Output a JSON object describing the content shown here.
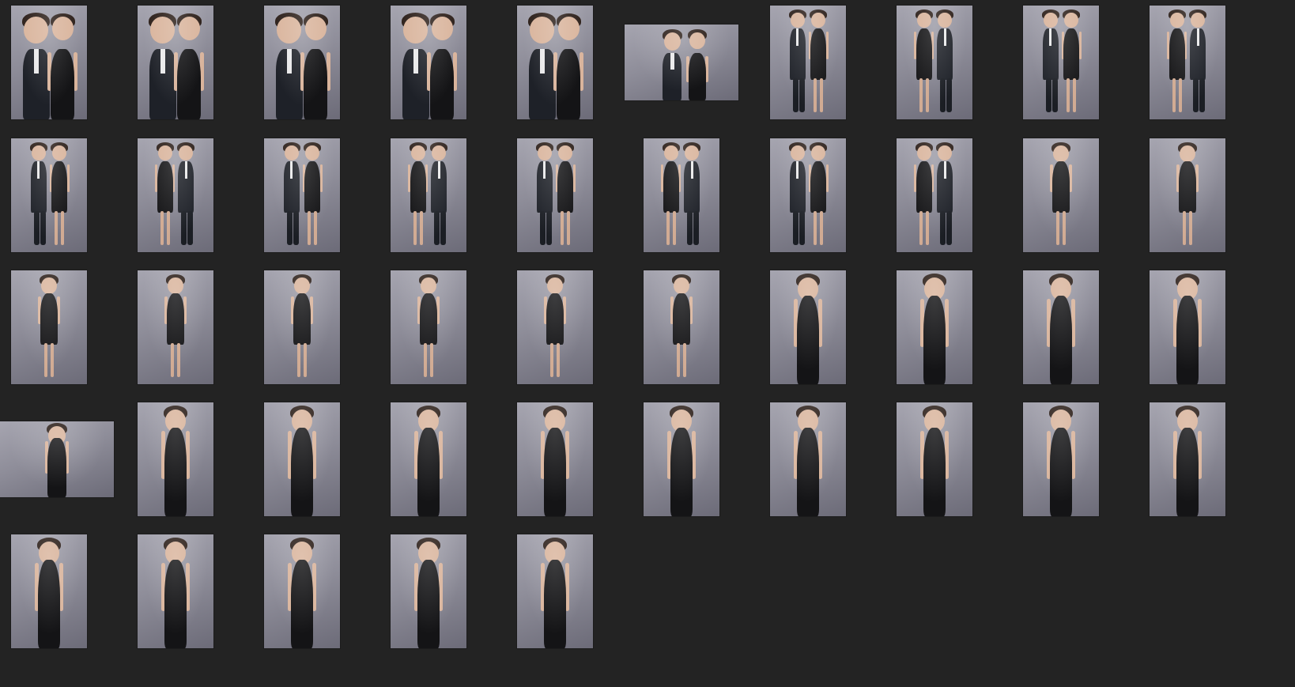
{
  "gallery": {
    "background_color": "#232323",
    "backdrop_color": "#9a99a5",
    "rows": [
      {
        "cells": [
          {
            "orientation": "portrait",
            "subject": "couple-suit-dress"
          },
          {
            "orientation": "portrait",
            "subject": "couple-suit-dress"
          },
          {
            "orientation": "portrait",
            "subject": "couple-suit-dress"
          },
          {
            "orientation": "portrait",
            "subject": "couple-suit-dress"
          },
          {
            "orientation": "portrait",
            "subject": "couple-suit-dress"
          },
          {
            "orientation": "landscape",
            "subject": "couple-suit-dress"
          },
          {
            "orientation": "portrait",
            "subject": "couple-full-length"
          },
          {
            "orientation": "portrait",
            "subject": "couple-full-length"
          },
          {
            "orientation": "portrait",
            "subject": "couple-full-length"
          },
          {
            "orientation": "portrait",
            "subject": "couple-full-length"
          }
        ]
      },
      {
        "cells": [
          {
            "orientation": "portrait",
            "subject": "couple-full-length"
          },
          {
            "orientation": "portrait",
            "subject": "couple-full-length"
          },
          {
            "orientation": "portrait",
            "subject": "couple-full-length"
          },
          {
            "orientation": "portrait",
            "subject": "couple-full-length"
          },
          {
            "orientation": "portrait",
            "subject": "couple-full-length"
          },
          {
            "orientation": "portrait",
            "subject": "couple-full-length"
          },
          {
            "orientation": "portrait",
            "subject": "couple-full-length"
          },
          {
            "orientation": "portrait",
            "subject": "couple-full-length"
          },
          {
            "orientation": "portrait",
            "subject": "woman-full-length"
          },
          {
            "orientation": "portrait",
            "subject": "woman-full-length"
          }
        ]
      },
      {
        "cells": [
          {
            "orientation": "portrait",
            "subject": "woman-full-length"
          },
          {
            "orientation": "portrait",
            "subject": "woman-full-length"
          },
          {
            "orientation": "portrait",
            "subject": "woman-full-length"
          },
          {
            "orientation": "portrait",
            "subject": "woman-full-length"
          },
          {
            "orientation": "portrait",
            "subject": "woman-full-length"
          },
          {
            "orientation": "portrait",
            "subject": "woman-full-length"
          },
          {
            "orientation": "portrait",
            "subject": "woman-half-length"
          },
          {
            "orientation": "portrait",
            "subject": "woman-half-length"
          },
          {
            "orientation": "portrait",
            "subject": "woman-half-length"
          },
          {
            "orientation": "portrait",
            "subject": "woman-half-length"
          }
        ]
      },
      {
        "cells": [
          {
            "orientation": "landscape",
            "subject": "woman-half-length"
          },
          {
            "orientation": "portrait",
            "subject": "woman-half-length"
          },
          {
            "orientation": "portrait",
            "subject": "woman-half-length"
          },
          {
            "orientation": "portrait",
            "subject": "woman-half-length"
          },
          {
            "orientation": "portrait",
            "subject": "woman-half-length"
          },
          {
            "orientation": "portrait",
            "subject": "woman-half-length"
          },
          {
            "orientation": "portrait",
            "subject": "woman-half-length"
          },
          {
            "orientation": "portrait",
            "subject": "woman-half-length"
          },
          {
            "orientation": "portrait",
            "subject": "woman-half-length"
          },
          {
            "orientation": "portrait",
            "subject": "woman-half-length"
          }
        ]
      },
      {
        "cells": [
          {
            "orientation": "portrait",
            "subject": "woman-half-length"
          },
          {
            "orientation": "portrait",
            "subject": "woman-half-length"
          },
          {
            "orientation": "portrait",
            "subject": "woman-half-length"
          },
          {
            "orientation": "portrait",
            "subject": "woman-half-length"
          },
          {
            "orientation": "portrait",
            "subject": "woman-half-length"
          }
        ]
      }
    ]
  }
}
